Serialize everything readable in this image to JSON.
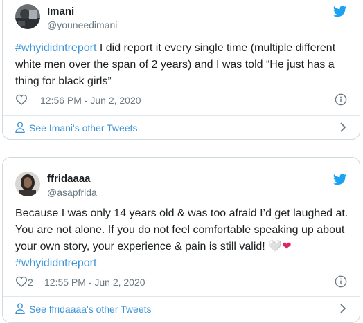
{
  "tweets": [
    {
      "name": "Imani",
      "handle": "@youneedimani",
      "hashtag": "#whyididntreport",
      "text": " I did report it every single time (multiple different white men over the span of 2 years) and  I was told “He just has a thing for black girls”",
      "likes": "",
      "timestamp": "12:56 PM - Jun 2, 2020",
      "more_link": "See Imani's other Tweets"
    },
    {
      "name": "ffridaaaa",
      "handle": "@asapfrida",
      "text": "Because I was only 14 years old & was too afraid I’d get laughed at.  You are not alone. If you do not feel comfortable speaking up about your own story, your experience & pain is still valid! ",
      "emoji": "🤍❤",
      "hashtag": "#whyididntreport",
      "likes": "2",
      "timestamp": "12:55 PM - Jun 2, 2020",
      "more_link": "See ffridaaaa's other Tweets"
    }
  ],
  "colors": {
    "link": "#3b94d9",
    "twitter_blue": "#1da1f2",
    "muted": "#697882",
    "border": "#cfd9de",
    "heart_red": "#e0245e"
  },
  "icons": [
    "twitter-bird-icon",
    "heart-outline-icon",
    "info-icon",
    "person-icon",
    "chevron-right-icon"
  ]
}
